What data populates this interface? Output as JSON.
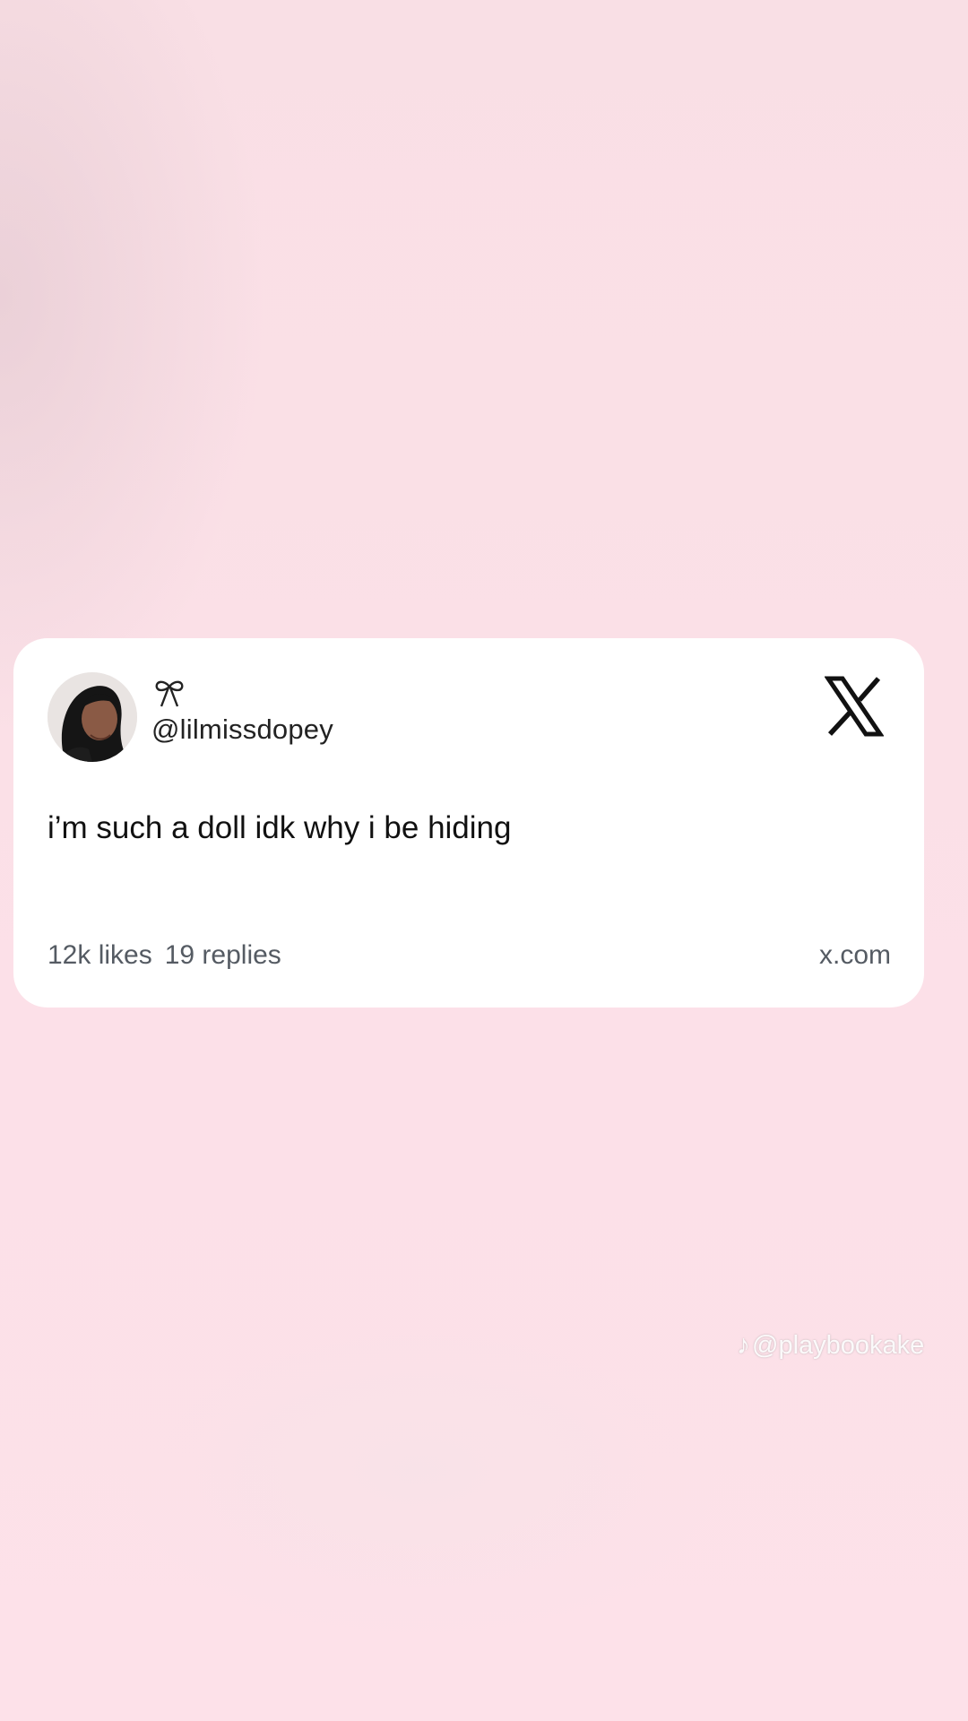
{
  "post": {
    "display_name_icon": "bow-icon",
    "handle": "@lilmissdopey",
    "text": "i’m such a doll idk why i be hiding",
    "likes": "12k likes",
    "replies": "19 replies",
    "domain": "x.com",
    "platform_logo": "x-logo-icon"
  },
  "overlay": {
    "watermark_icon": "tiktok-note-icon",
    "watermark_text": "@playbookake"
  },
  "colors": {
    "background": "#fbe0e7",
    "card": "#ffffff",
    "text": "#111111",
    "muted": "#555b63"
  }
}
